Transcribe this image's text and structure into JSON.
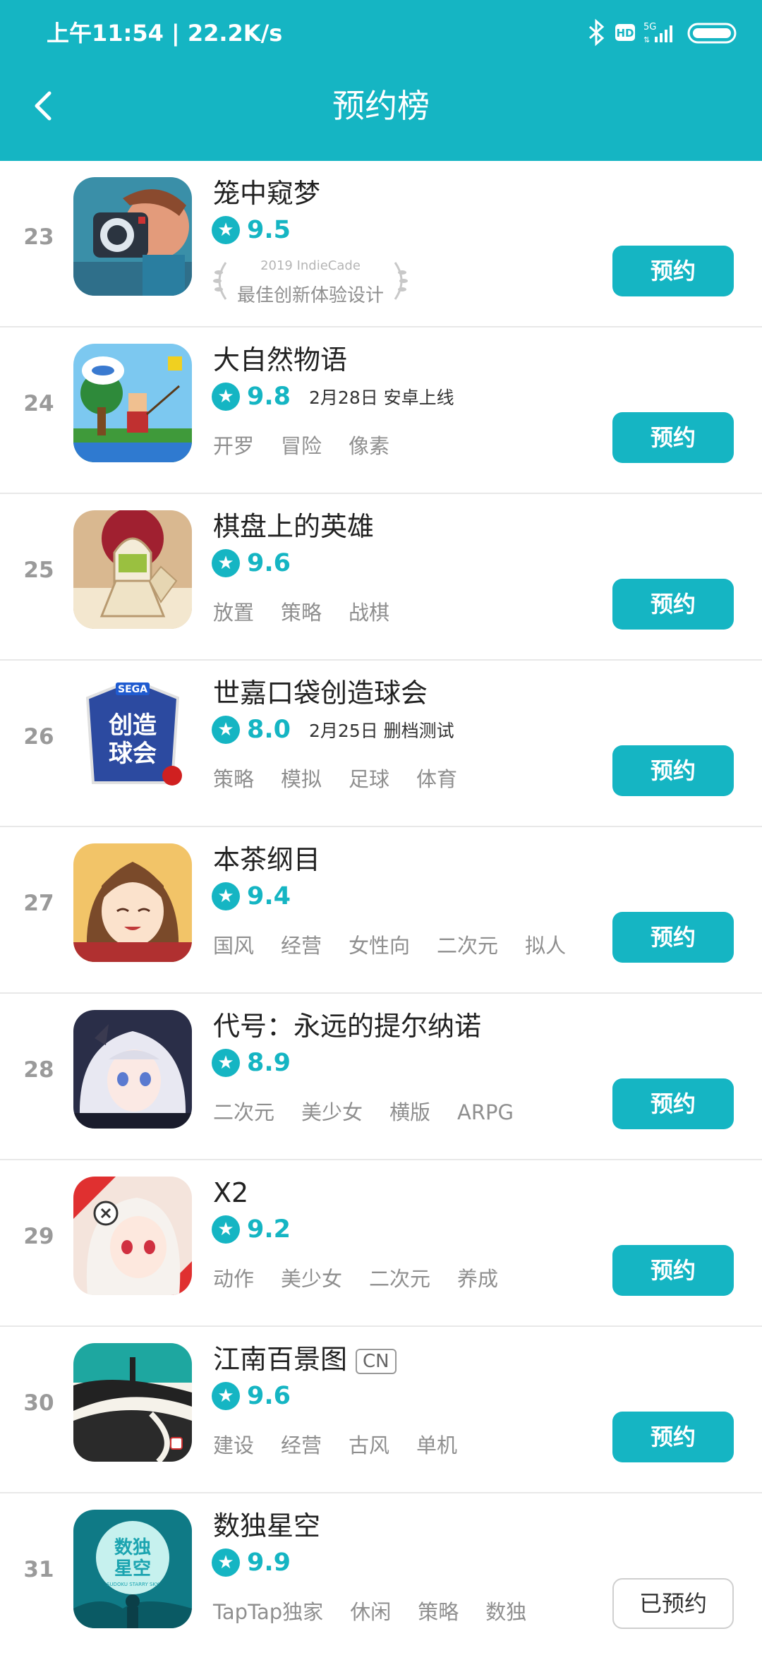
{
  "status_bar": {
    "time": "上午11:54 | 22.2K/s",
    "network": "5G"
  },
  "header": {
    "title": "预约榜"
  },
  "award": {
    "year": "2019 IndieCade",
    "name": "最佳创新体验设计"
  },
  "rows": [
    {
      "rank": "23",
      "title": "笼中窥梦",
      "score": "9.5",
      "note": "",
      "badge": "",
      "tags": [],
      "button": "预约"
    },
    {
      "rank": "24",
      "title": "大自然物语",
      "score": "9.8",
      "note": "2月28日 安卓上线",
      "badge": "",
      "tags": [
        "开罗",
        "冒险",
        "像素"
      ],
      "button": "预约"
    },
    {
      "rank": "25",
      "title": "棋盘上的英雄",
      "score": "9.6",
      "note": "",
      "badge": "",
      "tags": [
        "放置",
        "策略",
        "战棋"
      ],
      "button": "预约"
    },
    {
      "rank": "26",
      "title": "世嘉口袋创造球会",
      "score": "8.0",
      "note": "2月25日 删档测试",
      "badge": "",
      "tags": [
        "策略",
        "模拟",
        "足球",
        "体育"
      ],
      "button": "预约"
    },
    {
      "rank": "27",
      "title": "本茶纲目",
      "score": "9.4",
      "note": "",
      "badge": "",
      "tags": [
        "国风",
        "经营",
        "女性向",
        "二次元",
        "拟人"
      ],
      "button": "预约"
    },
    {
      "rank": "28",
      "title": "代号：永远的提尔纳诺",
      "score": "8.9",
      "note": "",
      "badge": "",
      "tags": [
        "二次元",
        "美少女",
        "横版",
        "ARPG"
      ],
      "button": "预约"
    },
    {
      "rank": "29",
      "title": "X2",
      "score": "9.2",
      "note": "",
      "badge": "",
      "tags": [
        "动作",
        "美少女",
        "二次元",
        "养成"
      ],
      "button": "预约"
    },
    {
      "rank": "30",
      "title": "江南百景图",
      "score": "9.6",
      "note": "",
      "badge": "CN",
      "tags": [
        "建设",
        "经营",
        "古风",
        "单机"
      ],
      "button": "预约"
    },
    {
      "rank": "31",
      "title": "数独星空",
      "score": "9.9",
      "note": "",
      "badge": "",
      "tags": [
        "TapTap独家",
        "休闲",
        "策略",
        "数独"
      ],
      "button": "已预约"
    }
  ],
  "icon_texts": {
    "sega_logo": "SEGA",
    "sega_title_1": "创造",
    "sega_title_2": "球会",
    "sudoku_1": "数独",
    "sudoku_2": "星空",
    "sudoku_en": "SUDOKU STARRY SKY"
  },
  "colors": {
    "accent": "#15b5c3",
    "button_text": "#ffffff",
    "tag_text": "#8f8f8f",
    "rank_text": "#9a9a9a"
  },
  "icons": {
    "back": "chevron-left-icon",
    "star": "star-icon",
    "bluetooth": "bluetooth-icon",
    "hd": "hd-icon",
    "signal": "signal-icon",
    "battery": "battery-icon"
  }
}
